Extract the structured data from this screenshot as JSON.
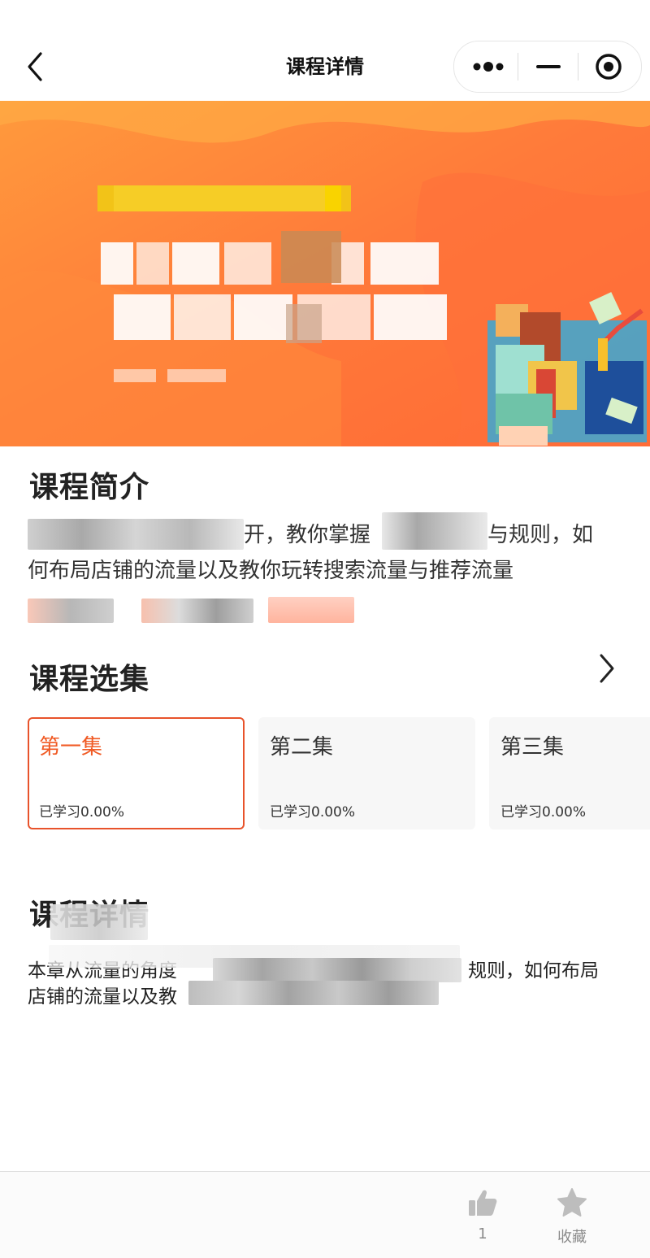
{
  "navbar": {
    "title": "课程详情",
    "back_icon": "chevron-left-icon",
    "more_icon": "more-dots-icon",
    "minimize_icon": "minimize-icon",
    "close_icon": "target-circle-icon"
  },
  "banner": {
    "accent_color": "#f7743a",
    "highlight_color": "#f5c400"
  },
  "intro": {
    "heading": "课程简介",
    "text_part1": "开，教你掌握",
    "text_part2": "与规则，如",
    "text_line2": "何布局店铺的流量以及教你玩转搜索流量与推荐流量"
  },
  "episodes": {
    "heading": "课程选集",
    "more_icon": "chevron-right-icon",
    "items": [
      {
        "name": "第一集",
        "progress": "已学习0.00%",
        "active": true
      },
      {
        "name": "第二集",
        "progress": "已学习0.00%",
        "active": false
      },
      {
        "name": "第三集",
        "progress": "已学习0.00%",
        "active": false
      }
    ]
  },
  "detail": {
    "heading": "课程详情",
    "line1_start": "本章从流量的角度",
    "line1_end": "规则，如何布局",
    "line2_start": "店铺的流量以及教"
  },
  "bottom_bar": {
    "like_icon": "thumbs-up-icon",
    "like_count": "1",
    "favorite_icon": "star-icon",
    "favorite_label": "收藏"
  },
  "colors": {
    "accent": "#f05a24",
    "active_border": "#e8532b",
    "inactive_icon": "#bdbdbd"
  }
}
